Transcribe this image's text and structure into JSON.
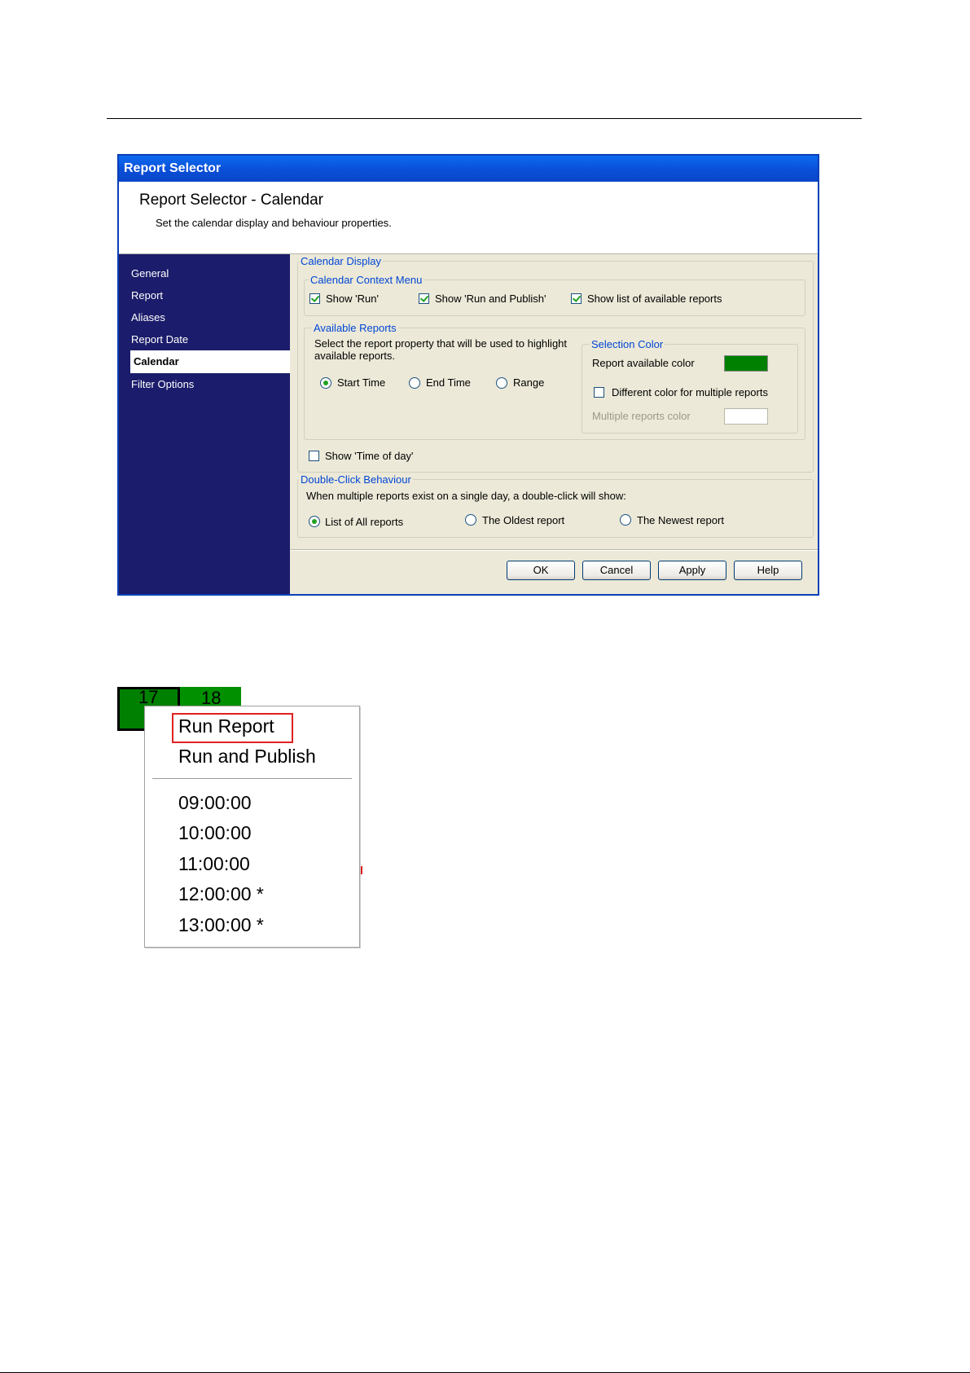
{
  "dialog": {
    "title": "Report Selector",
    "header_title": "Report Selector - Calendar",
    "header_subtitle": "Set the calendar display and behaviour properties.",
    "sidebar": {
      "items": [
        {
          "label": "General",
          "active": false
        },
        {
          "label": "Report",
          "active": false
        },
        {
          "label": "Aliases",
          "active": false
        },
        {
          "label": "Report Date",
          "active": false
        },
        {
          "label": "Calendar",
          "active": true
        },
        {
          "label": "Filter Options",
          "active": false
        }
      ]
    },
    "calendar_display": {
      "legend": "Calendar Display",
      "context_menu": {
        "legend": "Calendar Context Menu",
        "show_run": {
          "label": "Show 'Run'",
          "checked": true
        },
        "show_run_publish": {
          "label": "Show 'Run and Publish'",
          "checked": true
        },
        "show_list": {
          "label": "Show list of available reports",
          "checked": true
        }
      },
      "available_reports": {
        "legend": "Available Reports",
        "description": "Select the report property that will be used to highlight",
        "description2": "available reports.",
        "options": [
          {
            "label": "Start Time",
            "selected": true
          },
          {
            "label": "End Time",
            "selected": false
          },
          {
            "label": "Range",
            "selected": false
          }
        ],
        "selection_color": {
          "legend": "Selection Color",
          "available_label": "Report available color",
          "available_color": "#008000",
          "different_color": {
            "label": "Different color for multiple reports",
            "checked": false
          },
          "multiple_label": "Multiple reports color",
          "multiple_color": "#ffffff"
        }
      },
      "show_time_of_day": {
        "label": "Show 'Time of day'",
        "checked": false
      }
    },
    "double_click": {
      "legend": "Double-Click Behaviour",
      "description": "When multiple reports exist on a single day, a double-click will show:",
      "options": [
        {
          "label": "List of All reports",
          "selected": true
        },
        {
          "label": "The Oldest report",
          "selected": false
        },
        {
          "label": "The Newest report",
          "selected": false
        }
      ]
    },
    "buttons": {
      "ok": "OK",
      "cancel": "Cancel",
      "apply": "Apply",
      "help": "Help"
    }
  },
  "calendar": {
    "day_17": "17",
    "day_18": "18",
    "cell_color": "#008000"
  },
  "context_menu": {
    "run_report": "Run Report",
    "run_publish": "Run and Publish",
    "times": [
      "09:00:00",
      "10:00:00",
      "11:00:00",
      "12:00:00 *",
      "13:00:00 *"
    ]
  }
}
